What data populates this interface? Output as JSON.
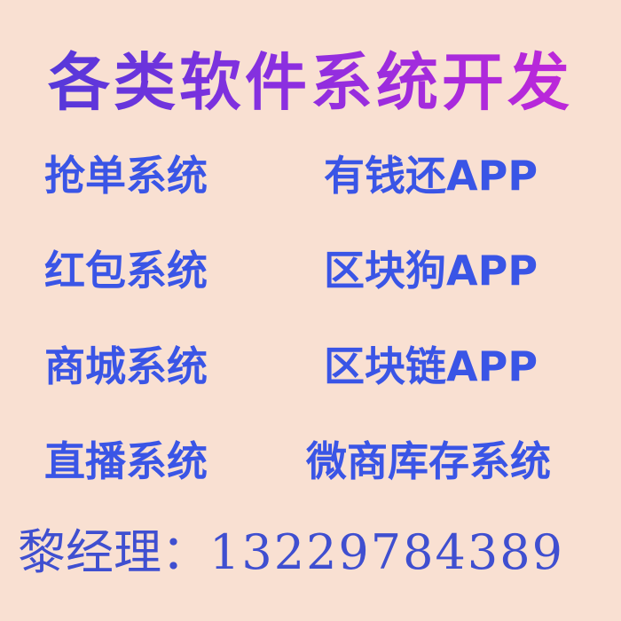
{
  "headline": "各类软件系统开发",
  "left_items": [
    "抢单系统",
    "红包系统",
    "商城系统",
    "直播系统"
  ],
  "right_items": [
    "有钱还APP",
    "区块狗APP",
    "区块链APP",
    "微商库存系统"
  ],
  "contact": {
    "name_label": "黎经理：",
    "phone": "13229784389"
  },
  "colors": {
    "background": "#f9e0d2",
    "headline_gradient_start": "#4a3ad8",
    "headline_gradient_end": "#c626d8",
    "item_text": "#3a55e6",
    "contact_text": "#3f4fd0"
  }
}
